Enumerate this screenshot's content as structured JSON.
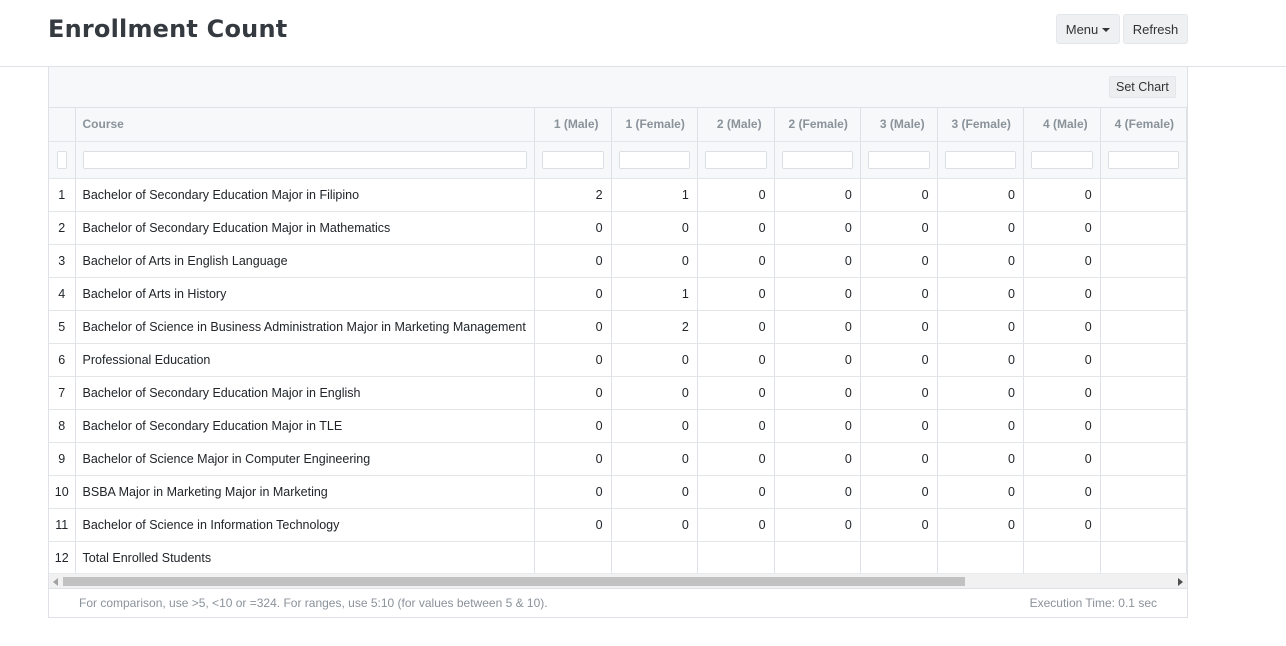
{
  "header": {
    "title": "Enrollment Count",
    "menu_label": "Menu",
    "refresh_label": "Refresh"
  },
  "toolbar": {
    "set_chart_label": "Set Chart"
  },
  "table": {
    "columns": [
      "",
      "Course",
      "1 (Male)",
      "1 (Female)",
      "2 (Male)",
      "2 (Female)",
      "3 (Male)",
      "3 (Female)",
      "4 (Male)",
      "4 (Female)"
    ],
    "rows": [
      {
        "idx": "1",
        "course": "Bachelor of Secondary Education Major in Filipino",
        "values": [
          "2",
          "1",
          "0",
          "0",
          "0",
          "0",
          "0",
          ""
        ]
      },
      {
        "idx": "2",
        "course": "Bachelor of Secondary Education Major in Mathematics",
        "values": [
          "0",
          "0",
          "0",
          "0",
          "0",
          "0",
          "0",
          ""
        ]
      },
      {
        "idx": "3",
        "course": "Bachelor of Arts in English Language",
        "values": [
          "0",
          "0",
          "0",
          "0",
          "0",
          "0",
          "0",
          ""
        ]
      },
      {
        "idx": "4",
        "course": "Bachelor of Arts in History",
        "values": [
          "0",
          "1",
          "0",
          "0",
          "0",
          "0",
          "0",
          ""
        ]
      },
      {
        "idx": "5",
        "course": "Bachelor of Science in Business Administration Major in Marketing Management",
        "values": [
          "0",
          "2",
          "0",
          "0",
          "0",
          "0",
          "0",
          ""
        ]
      },
      {
        "idx": "6",
        "course": "Professional Education",
        "values": [
          "0",
          "0",
          "0",
          "0",
          "0",
          "0",
          "0",
          ""
        ]
      },
      {
        "idx": "7",
        "course": "Bachelor of Secondary Education Major in English",
        "values": [
          "0",
          "0",
          "0",
          "0",
          "0",
          "0",
          "0",
          ""
        ]
      },
      {
        "idx": "8",
        "course": "Bachelor of Secondary Education Major in TLE",
        "values": [
          "0",
          "0",
          "0",
          "0",
          "0",
          "0",
          "0",
          ""
        ]
      },
      {
        "idx": "9",
        "course": "Bachelor of Science Major in Computer Engineering",
        "values": [
          "0",
          "0",
          "0",
          "0",
          "0",
          "0",
          "0",
          ""
        ]
      },
      {
        "idx": "10",
        "course": "BSBA Major in Marketing Major in Marketing",
        "values": [
          "0",
          "0",
          "0",
          "0",
          "0",
          "0",
          "0",
          ""
        ]
      },
      {
        "idx": "11",
        "course": "Bachelor of Science in Information Technology",
        "values": [
          "0",
          "0",
          "0",
          "0",
          "0",
          "0",
          "0",
          ""
        ]
      },
      {
        "idx": "12",
        "course": "Total Enrolled Students",
        "values": [
          "",
          "",
          "",
          "",
          "",
          "",
          "",
          ""
        ]
      }
    ]
  },
  "footer": {
    "hint": "For comparison, use >5, <10 or =324. For ranges, use 5:10 (for values between 5 & 10).",
    "execution_time": "Execution Time: 0.1 sec"
  }
}
